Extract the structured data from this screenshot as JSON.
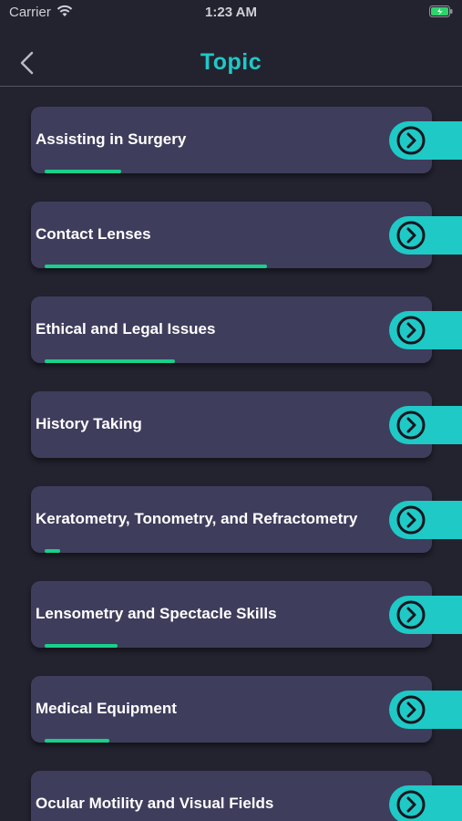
{
  "status_bar": {
    "carrier": "Carrier",
    "time": "1:23 AM",
    "battery_color": "#2fd36b"
  },
  "nav": {
    "title": "Topic",
    "title_color": "#1fc9c6",
    "back_icon": "chevron-left-icon"
  },
  "colors": {
    "background": "#232330",
    "card": "#3f3d5c",
    "accent": "#1fc9c6",
    "progress": "#19d08a"
  },
  "topics": [
    {
      "label": "Assisting in Surgery",
      "progress": 0.2
    },
    {
      "label": "Contact Lenses",
      "progress": 0.58
    },
    {
      "label": "Ethical and Legal Issues",
      "progress": 0.34
    },
    {
      "label": "History Taking",
      "progress": 0.0
    },
    {
      "label": "Keratometry, Tonometry, and Refractometry",
      "progress": 0.04
    },
    {
      "label": "Lensometry and Spectacle Skills",
      "progress": 0.19
    },
    {
      "label": "Medical Equipment",
      "progress": 0.17
    },
    {
      "label": "Ocular Motility and Visual Fields",
      "progress": 0.0
    }
  ]
}
